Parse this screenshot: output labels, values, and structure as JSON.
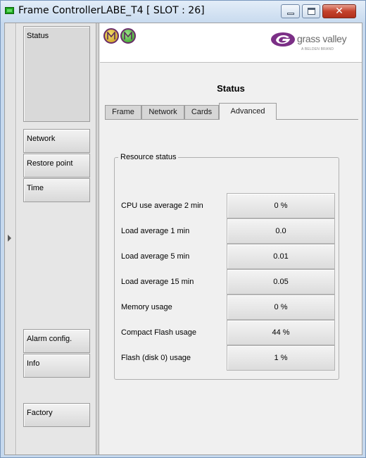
{
  "window": {
    "title": "Frame ControllerLABE_T4 [ SLOT : 26]",
    "accent_color": "#1fa81f",
    "close_color": "#c4422c"
  },
  "icons": {
    "window_icon": "monitor-icon",
    "minimize": "minimize-icon",
    "maximize": "maximize-icon",
    "close": "close-icon",
    "collapse": "chevron-right-icon",
    "status_icon_1": "status-ok-icon",
    "status_icon_2": "status-ok-icon"
  },
  "logo": {
    "brand": "grass valley",
    "tagline": "A BELDEN BRAND"
  },
  "nav": {
    "items": [
      {
        "label": "Status"
      },
      {
        "label": "Network"
      },
      {
        "label": "Restore point"
      },
      {
        "label": "Time"
      },
      {
        "label": "Alarm config."
      },
      {
        "label": "Info"
      },
      {
        "label": "Factory"
      }
    ]
  },
  "main": {
    "title": "Status",
    "tabs": [
      {
        "label": "Frame"
      },
      {
        "label": "Network"
      },
      {
        "label": "Cards"
      },
      {
        "label": "Advanced"
      }
    ],
    "active_tab": "Advanced"
  },
  "resource_status": {
    "legend": "Resource status",
    "rows": [
      {
        "label": "CPU use average 2 min",
        "value": "0 %"
      },
      {
        "label": "Load average 1 min",
        "value": "0.0"
      },
      {
        "label": "Load average 5 min",
        "value": "0.01"
      },
      {
        "label": "Load average 15 min",
        "value": "0.05"
      },
      {
        "label": "Memory usage",
        "value": "0 %"
      },
      {
        "label": "Compact Flash usage",
        "value": "44 %"
      },
      {
        "label": "Flash (disk 0) usage",
        "value": "1 %"
      }
    ]
  }
}
